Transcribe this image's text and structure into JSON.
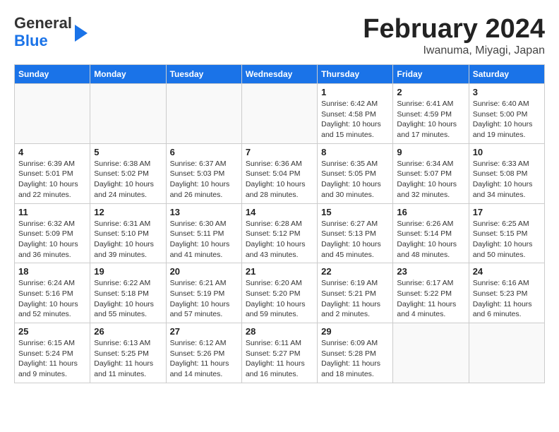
{
  "header": {
    "logo_line1": "General",
    "logo_line2": "Blue",
    "month": "February 2024",
    "location": "Iwanuma, Miyagi, Japan"
  },
  "days_of_week": [
    "Sunday",
    "Monday",
    "Tuesday",
    "Wednesday",
    "Thursday",
    "Friday",
    "Saturday"
  ],
  "weeks": [
    [
      {
        "num": "",
        "info": ""
      },
      {
        "num": "",
        "info": ""
      },
      {
        "num": "",
        "info": ""
      },
      {
        "num": "",
        "info": ""
      },
      {
        "num": "1",
        "info": "Sunrise: 6:42 AM\nSunset: 4:58 PM\nDaylight: 10 hours\nand 15 minutes."
      },
      {
        "num": "2",
        "info": "Sunrise: 6:41 AM\nSunset: 4:59 PM\nDaylight: 10 hours\nand 17 minutes."
      },
      {
        "num": "3",
        "info": "Sunrise: 6:40 AM\nSunset: 5:00 PM\nDaylight: 10 hours\nand 19 minutes."
      }
    ],
    [
      {
        "num": "4",
        "info": "Sunrise: 6:39 AM\nSunset: 5:01 PM\nDaylight: 10 hours\nand 22 minutes."
      },
      {
        "num": "5",
        "info": "Sunrise: 6:38 AM\nSunset: 5:02 PM\nDaylight: 10 hours\nand 24 minutes."
      },
      {
        "num": "6",
        "info": "Sunrise: 6:37 AM\nSunset: 5:03 PM\nDaylight: 10 hours\nand 26 minutes."
      },
      {
        "num": "7",
        "info": "Sunrise: 6:36 AM\nSunset: 5:04 PM\nDaylight: 10 hours\nand 28 minutes."
      },
      {
        "num": "8",
        "info": "Sunrise: 6:35 AM\nSunset: 5:05 PM\nDaylight: 10 hours\nand 30 minutes."
      },
      {
        "num": "9",
        "info": "Sunrise: 6:34 AM\nSunset: 5:07 PM\nDaylight: 10 hours\nand 32 minutes."
      },
      {
        "num": "10",
        "info": "Sunrise: 6:33 AM\nSunset: 5:08 PM\nDaylight: 10 hours\nand 34 minutes."
      }
    ],
    [
      {
        "num": "11",
        "info": "Sunrise: 6:32 AM\nSunset: 5:09 PM\nDaylight: 10 hours\nand 36 minutes."
      },
      {
        "num": "12",
        "info": "Sunrise: 6:31 AM\nSunset: 5:10 PM\nDaylight: 10 hours\nand 39 minutes."
      },
      {
        "num": "13",
        "info": "Sunrise: 6:30 AM\nSunset: 5:11 PM\nDaylight: 10 hours\nand 41 minutes."
      },
      {
        "num": "14",
        "info": "Sunrise: 6:28 AM\nSunset: 5:12 PM\nDaylight: 10 hours\nand 43 minutes."
      },
      {
        "num": "15",
        "info": "Sunrise: 6:27 AM\nSunset: 5:13 PM\nDaylight: 10 hours\nand 45 minutes."
      },
      {
        "num": "16",
        "info": "Sunrise: 6:26 AM\nSunset: 5:14 PM\nDaylight: 10 hours\nand 48 minutes."
      },
      {
        "num": "17",
        "info": "Sunrise: 6:25 AM\nSunset: 5:15 PM\nDaylight: 10 hours\nand 50 minutes."
      }
    ],
    [
      {
        "num": "18",
        "info": "Sunrise: 6:24 AM\nSunset: 5:16 PM\nDaylight: 10 hours\nand 52 minutes."
      },
      {
        "num": "19",
        "info": "Sunrise: 6:22 AM\nSunset: 5:18 PM\nDaylight: 10 hours\nand 55 minutes."
      },
      {
        "num": "20",
        "info": "Sunrise: 6:21 AM\nSunset: 5:19 PM\nDaylight: 10 hours\nand 57 minutes."
      },
      {
        "num": "21",
        "info": "Sunrise: 6:20 AM\nSunset: 5:20 PM\nDaylight: 10 hours\nand 59 minutes."
      },
      {
        "num": "22",
        "info": "Sunrise: 6:19 AM\nSunset: 5:21 PM\nDaylight: 11 hours\nand 2 minutes."
      },
      {
        "num": "23",
        "info": "Sunrise: 6:17 AM\nSunset: 5:22 PM\nDaylight: 11 hours\nand 4 minutes."
      },
      {
        "num": "24",
        "info": "Sunrise: 6:16 AM\nSunset: 5:23 PM\nDaylight: 11 hours\nand 6 minutes."
      }
    ],
    [
      {
        "num": "25",
        "info": "Sunrise: 6:15 AM\nSunset: 5:24 PM\nDaylight: 11 hours\nand 9 minutes."
      },
      {
        "num": "26",
        "info": "Sunrise: 6:13 AM\nSunset: 5:25 PM\nDaylight: 11 hours\nand 11 minutes."
      },
      {
        "num": "27",
        "info": "Sunrise: 6:12 AM\nSunset: 5:26 PM\nDaylight: 11 hours\nand 14 minutes."
      },
      {
        "num": "28",
        "info": "Sunrise: 6:11 AM\nSunset: 5:27 PM\nDaylight: 11 hours\nand 16 minutes."
      },
      {
        "num": "29",
        "info": "Sunrise: 6:09 AM\nSunset: 5:28 PM\nDaylight: 11 hours\nand 18 minutes."
      },
      {
        "num": "",
        "info": ""
      },
      {
        "num": "",
        "info": ""
      }
    ]
  ]
}
